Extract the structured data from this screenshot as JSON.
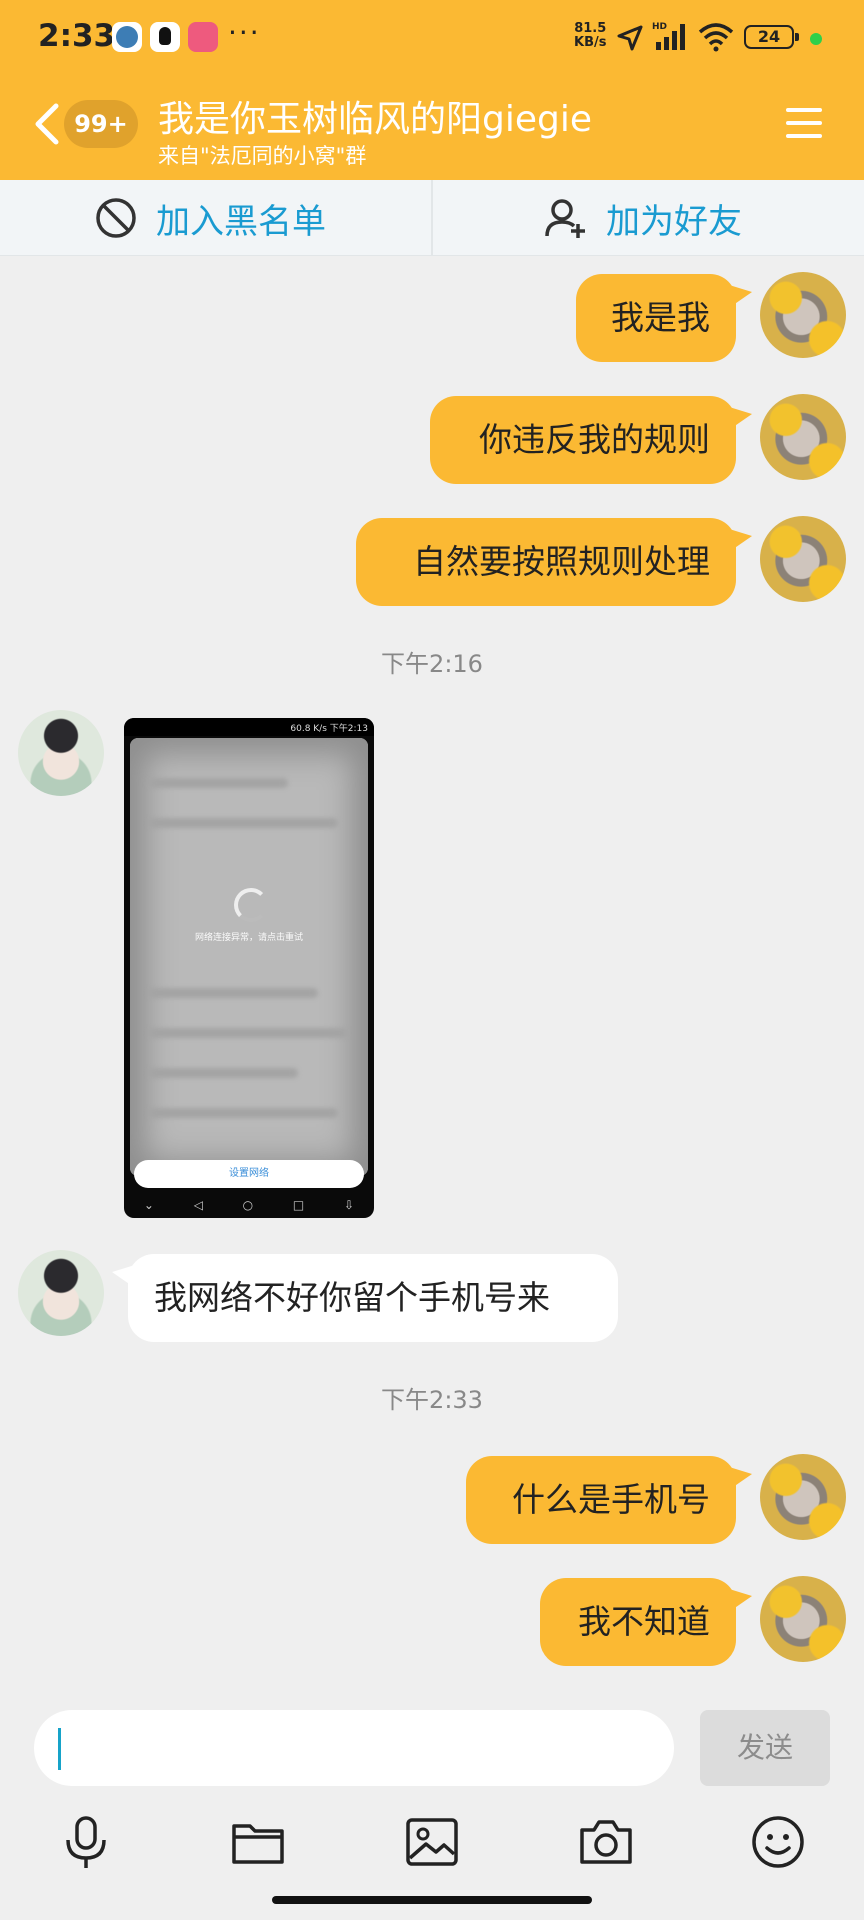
{
  "status_bar": {
    "time": "2:33",
    "net_speed_top": "81.5",
    "net_speed_bottom": "KB/s",
    "battery": "24",
    "icons": [
      "telegram-icon",
      "qq-icon",
      "bilibili-icon",
      "more-dots-icon",
      "location-arrow-icon",
      "signal-icon",
      "wifi-icon",
      "battery-icon"
    ],
    "more": "···"
  },
  "header": {
    "unread_badge": "99+",
    "title": "我是你玉树临风的阳giegie",
    "subtitle": "来自\"法厄同的小窝\"群"
  },
  "actions": {
    "blacklist": "加入黑名单",
    "add_friend": "加为好友"
  },
  "messages": [
    {
      "from": "me",
      "text": "我是我"
    },
    {
      "from": "me",
      "text": "你违反我的规则"
    },
    {
      "from": "me",
      "text": "自然要按照规则处理"
    },
    {
      "from": "other",
      "text": "我网络不好你留个手机号来"
    },
    {
      "from": "me",
      "text": "什么是手机号"
    },
    {
      "from": "me",
      "text": "我不知道"
    }
  ],
  "timestamps": [
    "下午2:16",
    "下午2:33"
  ],
  "image_message": {
    "status_text": "60.8 K/s",
    "status_time": "下午2:13",
    "error_text": "网络连接异常，请点击重试",
    "button": "设置网络"
  },
  "composer": {
    "send_label": "发送"
  },
  "colors": {
    "accent": "#fbb933",
    "link": "#1a9bd1",
    "background": "#efefef"
  }
}
